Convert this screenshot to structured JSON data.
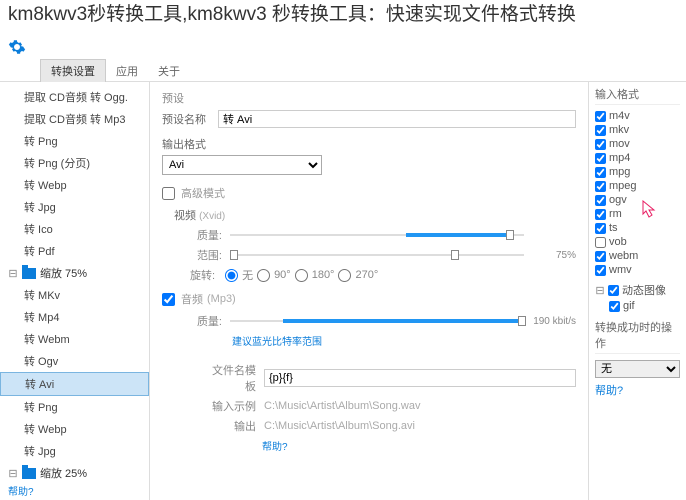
{
  "overlay_title": "km8kwv3秒转换工具,km8kwv3 秒转换工具：快速实现文件格式转换",
  "menubar": {
    "tab1": "转换设置",
    "tab2": "应用",
    "tab3": "关于"
  },
  "left": {
    "items_top": [
      "提取 CD音频 转 Ogg.",
      "提取 CD音频 转 Mp3",
      "转 Png",
      "转 Png (分页)",
      "转 Webp",
      "转 Jpg",
      "转 Ico",
      "转 Pdf"
    ],
    "folder1": "缩放 75%",
    "items_mid": [
      "转 MKv",
      "转 Mp4",
      "转 Webm",
      "转 Ogv",
      "转 Avi",
      "转 Png",
      "转 Webp",
      "转 Jpg"
    ],
    "folder2": "缩放 25%"
  },
  "center": {
    "preset_header": "预设",
    "preset_name_label": "预设名称",
    "preset_name_value": "转 Avi",
    "output_format_label": "输出格式",
    "output_format_value": "Avi",
    "advanced_mode": "高级模式",
    "video_label": "视频",
    "video_codec": "(Xvid)",
    "quality_label": "质量:",
    "range_label": "范围:",
    "range_value": "75%",
    "rotate_label": "旋转:",
    "rotate_options": [
      "无",
      "90°",
      "180°",
      "270°"
    ],
    "audio_label": "音频",
    "audio_codec": "(Mp3)",
    "bitrate_value": "190 kbit/s",
    "advice": "建议蓝光比特率范围",
    "filename_template_label": "文件名模板",
    "filename_template_value": "{p}{f}",
    "input_example_label": "输入示例",
    "input_example_value": "C:\\Music\\Artist\\Album\\Song.wav",
    "output_label": "输出",
    "output_value": "C:\\Music\\Artist\\Album\\Song.avi",
    "help": "帮助?"
  },
  "right": {
    "input_formats_label": "输入格式",
    "formats": [
      "m4v",
      "mkv",
      "mov",
      "mp4",
      "mpg",
      "mpeg",
      "ogv",
      "rm",
      "ts",
      "vob",
      "webm",
      "wmv"
    ],
    "vob_checked": false,
    "animated_label": "动态图像",
    "gif": "gif",
    "action_label": "转换成功时的操作",
    "action_value": "无"
  },
  "footer_help": "帮助?"
}
